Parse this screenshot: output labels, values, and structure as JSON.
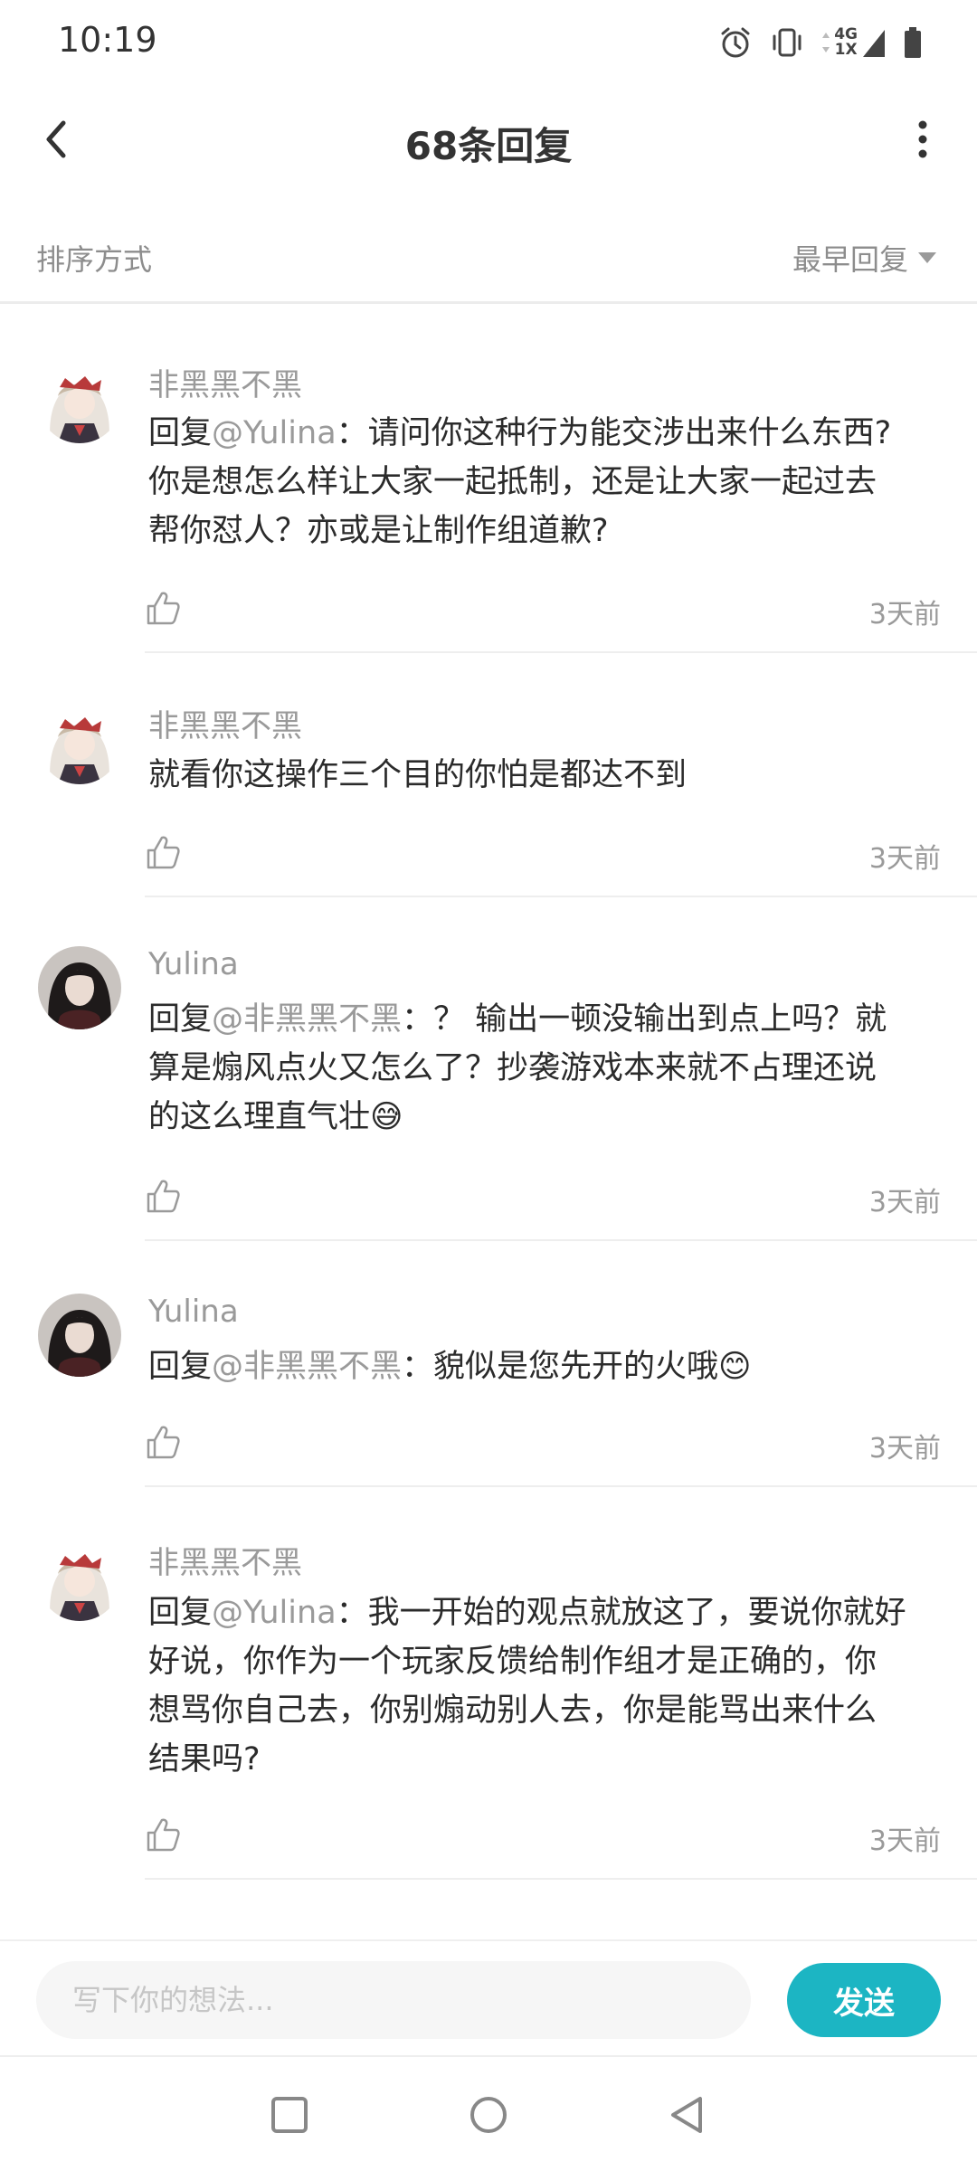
{
  "status_bar": {
    "time": "10:19",
    "network_top": "4G",
    "network_bottom": "1X",
    "icons": [
      "alarm-icon",
      "vibrate-icon",
      "signal-icon",
      "battery-icon"
    ]
  },
  "header": {
    "title": "68条回复",
    "back_icon": "chevron-left-icon",
    "more_icon": "more-vertical-icon"
  },
  "sort": {
    "label": "排序方式",
    "value": "最早回复"
  },
  "colors": {
    "accent": "#1cb5c3",
    "muted_text": "#9a9a9a",
    "body_text": "#2b2b2b"
  },
  "comments": [
    {
      "author": "非黑黑不黑",
      "reply_prefix": "回复",
      "mention": "@Yulina",
      "separator": "：",
      "text_lines": [
        "请问你这种行为能交涉出来什么东西?",
        "你是想怎么样让大家一起抵制，还是让大家一起过去",
        "帮你怼人？亦或是让制作组道歉?"
      ],
      "time": "3天前"
    },
    {
      "author": "非黑黑不黑",
      "reply_prefix": "",
      "mention": "",
      "separator": "",
      "text_lines": [
        "就看你这操作三个目的你怕是都达不到"
      ],
      "time": "3天前"
    },
    {
      "author": "Yulina",
      "reply_prefix": "回复",
      "mention": "@非黑黑不黑",
      "separator": "：",
      "text_lines": [
        "？ 输出一顿没输出到点上吗？就",
        "算是煽风点火又怎么了？抄袭游戏本来就不占理还说",
        "的这么理直气壮😅"
      ],
      "time": "3天前"
    },
    {
      "author": "Yulina",
      "reply_prefix": "回复",
      "mention": "@非黑黑不黑",
      "separator": "：",
      "text_lines": [
        "貌似是您先开的火哦😊"
      ],
      "time": "3天前"
    },
    {
      "author": "非黑黑不黑",
      "reply_prefix": "回复",
      "mention": "@Yulina",
      "separator": "：",
      "text_lines": [
        "我一开始的观点就放这了，要说你就好",
        "好说，你作为一个玩家反馈给制作组才是正确的，你",
        "想骂你自己去，你别煽动别人去，你是能骂出来什么",
        "结果吗?"
      ],
      "time": "3天前"
    }
  ],
  "input": {
    "placeholder": "写下你的想法...",
    "send_label": "发送"
  },
  "nav": {
    "icons": [
      "square-recents-icon",
      "circle-home-icon",
      "triangle-back-icon"
    ]
  }
}
